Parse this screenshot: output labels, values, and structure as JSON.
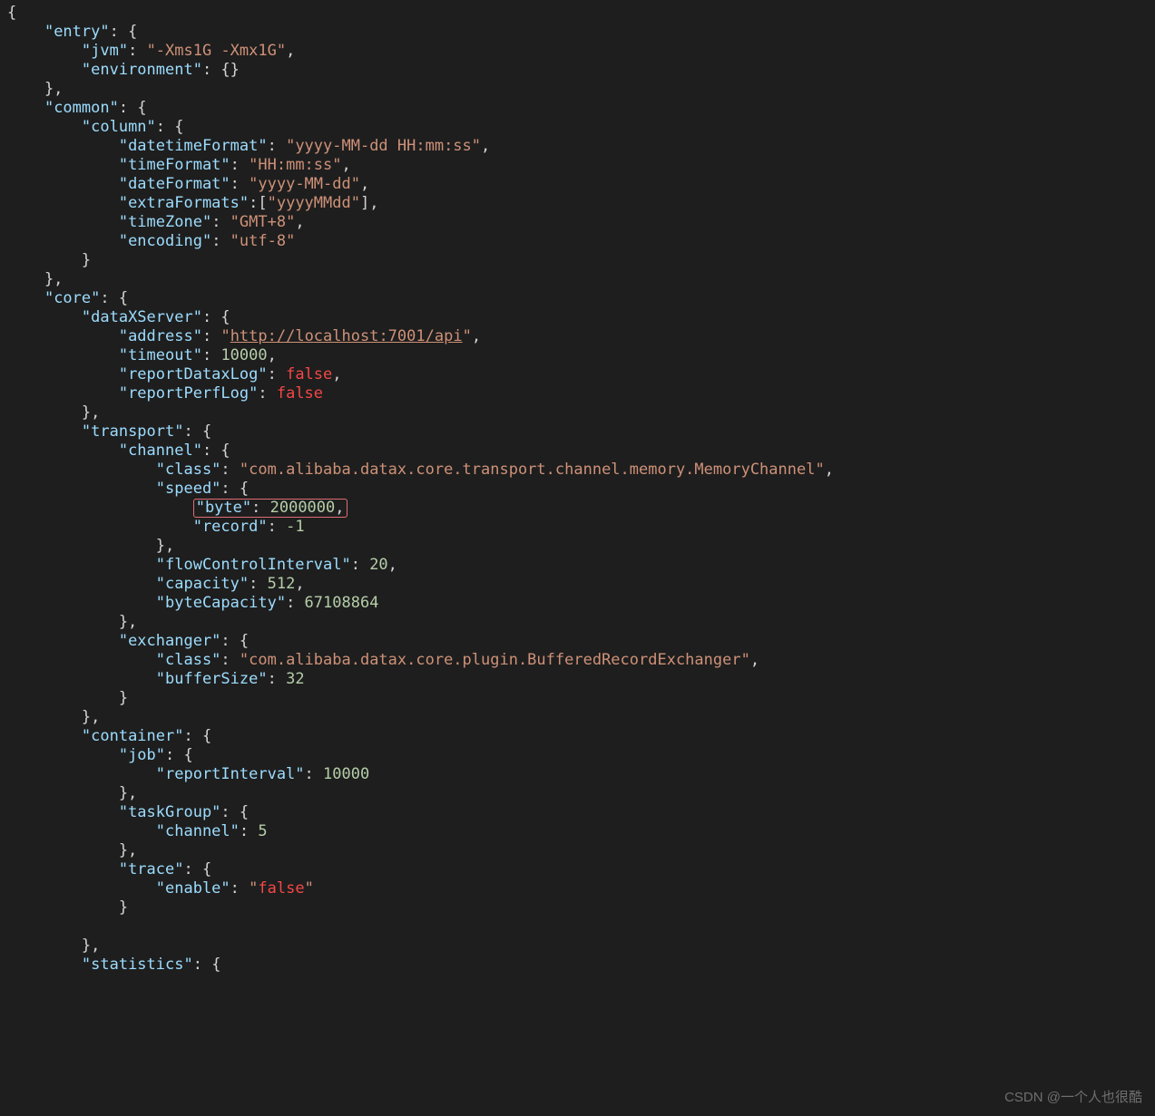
{
  "lines": [
    {
      "tokens": [
        {
          "t": "{",
          "c": "p"
        }
      ]
    },
    {
      "tokens": [
        {
          "t": "    ",
          "c": "p"
        },
        {
          "t": "\"entry\"",
          "c": "k"
        },
        {
          "t": ": {",
          "c": "p"
        }
      ]
    },
    {
      "tokens": [
        {
          "t": "        ",
          "c": "p"
        },
        {
          "t": "\"jvm\"",
          "c": "k"
        },
        {
          "t": ": ",
          "c": "p"
        },
        {
          "t": "\"-Xms1G -Xmx1G\"",
          "c": "s"
        },
        {
          "t": ",",
          "c": "p"
        }
      ]
    },
    {
      "tokens": [
        {
          "t": "        ",
          "c": "p"
        },
        {
          "t": "\"environment\"",
          "c": "k"
        },
        {
          "t": ": {}",
          "c": "p"
        }
      ]
    },
    {
      "tokens": [
        {
          "t": "    },",
          "c": "p"
        }
      ]
    },
    {
      "tokens": [
        {
          "t": "    ",
          "c": "p"
        },
        {
          "t": "\"common\"",
          "c": "k"
        },
        {
          "t": ": {",
          "c": "p"
        }
      ]
    },
    {
      "tokens": [
        {
          "t": "        ",
          "c": "p"
        },
        {
          "t": "\"column\"",
          "c": "k"
        },
        {
          "t": ": {",
          "c": "p"
        }
      ]
    },
    {
      "tokens": [
        {
          "t": "            ",
          "c": "p"
        },
        {
          "t": "\"datetimeFormat\"",
          "c": "k"
        },
        {
          "t": ": ",
          "c": "p"
        },
        {
          "t": "\"yyyy-MM-dd HH:mm:ss\"",
          "c": "s"
        },
        {
          "t": ",",
          "c": "p"
        }
      ]
    },
    {
      "tokens": [
        {
          "t": "            ",
          "c": "p"
        },
        {
          "t": "\"timeFormat\"",
          "c": "k"
        },
        {
          "t": ": ",
          "c": "p"
        },
        {
          "t": "\"HH:mm:ss\"",
          "c": "s"
        },
        {
          "t": ",",
          "c": "p"
        }
      ]
    },
    {
      "tokens": [
        {
          "t": "            ",
          "c": "p"
        },
        {
          "t": "\"dateFormat\"",
          "c": "k"
        },
        {
          "t": ": ",
          "c": "p"
        },
        {
          "t": "\"yyyy-MM-dd\"",
          "c": "s"
        },
        {
          "t": ",",
          "c": "p"
        }
      ]
    },
    {
      "tokens": [
        {
          "t": "            ",
          "c": "p"
        },
        {
          "t": "\"extraFormats\"",
          "c": "k"
        },
        {
          "t": ":[",
          "c": "p"
        },
        {
          "t": "\"yyyyMMdd\"",
          "c": "s"
        },
        {
          "t": "],",
          "c": "p"
        }
      ]
    },
    {
      "tokens": [
        {
          "t": "            ",
          "c": "p"
        },
        {
          "t": "\"timeZone\"",
          "c": "k"
        },
        {
          "t": ": ",
          "c": "p"
        },
        {
          "t": "\"GMT+8\"",
          "c": "s"
        },
        {
          "t": ",",
          "c": "p"
        }
      ]
    },
    {
      "tokens": [
        {
          "t": "            ",
          "c": "p"
        },
        {
          "t": "\"encoding\"",
          "c": "k"
        },
        {
          "t": ": ",
          "c": "p"
        },
        {
          "t": "\"utf-8\"",
          "c": "s"
        }
      ]
    },
    {
      "tokens": [
        {
          "t": "        }",
          "c": "p"
        }
      ]
    },
    {
      "tokens": [
        {
          "t": "    },",
          "c": "p"
        }
      ]
    },
    {
      "tokens": [
        {
          "t": "    ",
          "c": "p"
        },
        {
          "t": "\"core\"",
          "c": "k"
        },
        {
          "t": ": {",
          "c": "p"
        }
      ]
    },
    {
      "tokens": [
        {
          "t": "        ",
          "c": "p"
        },
        {
          "t": "\"dataXServer\"",
          "c": "k"
        },
        {
          "t": ": {",
          "c": "p"
        }
      ]
    },
    {
      "tokens": [
        {
          "t": "            ",
          "c": "p"
        },
        {
          "t": "\"address\"",
          "c": "k"
        },
        {
          "t": ": ",
          "c": "p"
        },
        {
          "t": "\"",
          "c": "s"
        },
        {
          "t": "http://localhost:7001/api",
          "c": "s u"
        },
        {
          "t": "\"",
          "c": "s"
        },
        {
          "t": ",",
          "c": "p"
        }
      ]
    },
    {
      "tokens": [
        {
          "t": "            ",
          "c": "p"
        },
        {
          "t": "\"timeout\"",
          "c": "k"
        },
        {
          "t": ": ",
          "c": "p"
        },
        {
          "t": "10000",
          "c": "n"
        },
        {
          "t": ",",
          "c": "p"
        }
      ]
    },
    {
      "tokens": [
        {
          "t": "            ",
          "c": "p"
        },
        {
          "t": "\"reportDataxLog\"",
          "c": "k"
        },
        {
          "t": ": ",
          "c": "p"
        },
        {
          "t": "false",
          "c": "b"
        },
        {
          "t": ",",
          "c": "p"
        }
      ]
    },
    {
      "tokens": [
        {
          "t": "            ",
          "c": "p"
        },
        {
          "t": "\"reportPerfLog\"",
          "c": "k"
        },
        {
          "t": ": ",
          "c": "p"
        },
        {
          "t": "false",
          "c": "b"
        }
      ]
    },
    {
      "tokens": [
        {
          "t": "        },",
          "c": "p"
        }
      ]
    },
    {
      "tokens": [
        {
          "t": "        ",
          "c": "p"
        },
        {
          "t": "\"transport\"",
          "c": "k"
        },
        {
          "t": ": {",
          "c": "p"
        }
      ]
    },
    {
      "tokens": [
        {
          "t": "            ",
          "c": "p"
        },
        {
          "t": "\"channel\"",
          "c": "k"
        },
        {
          "t": ": {",
          "c": "p"
        }
      ]
    },
    {
      "tokens": [
        {
          "t": "                ",
          "c": "p"
        },
        {
          "t": "\"class\"",
          "c": "k"
        },
        {
          "t": ": ",
          "c": "p"
        },
        {
          "t": "\"com.alibaba.datax.core.transport.channel.memory.MemoryChannel\"",
          "c": "s"
        },
        {
          "t": ",",
          "c": "p"
        }
      ]
    },
    {
      "tokens": [
        {
          "t": "                ",
          "c": "p"
        },
        {
          "t": "\"speed\"",
          "c": "k"
        },
        {
          "t": ": {",
          "c": "p"
        }
      ]
    },
    {
      "highlight": true,
      "tokens": [
        {
          "t": "                    ",
          "c": "p"
        },
        {
          "t": "\"byte\"",
          "c": "k",
          "hlstart": true
        },
        {
          "t": ": ",
          "c": "p"
        },
        {
          "t": "2000000",
          "c": "n"
        },
        {
          "t": ",",
          "c": "p",
          "hlend": true
        }
      ]
    },
    {
      "tokens": [
        {
          "t": "                    ",
          "c": "p"
        },
        {
          "t": "\"record\"",
          "c": "k"
        },
        {
          "t": ": ",
          "c": "p"
        },
        {
          "t": "-1",
          "c": "n"
        }
      ]
    },
    {
      "tokens": [
        {
          "t": "                },",
          "c": "p"
        }
      ]
    },
    {
      "tokens": [
        {
          "t": "                ",
          "c": "p"
        },
        {
          "t": "\"flowControlInterval\"",
          "c": "k"
        },
        {
          "t": ": ",
          "c": "p"
        },
        {
          "t": "20",
          "c": "n"
        },
        {
          "t": ",",
          "c": "p"
        }
      ]
    },
    {
      "tokens": [
        {
          "t": "                ",
          "c": "p"
        },
        {
          "t": "\"capacity\"",
          "c": "k"
        },
        {
          "t": ": ",
          "c": "p"
        },
        {
          "t": "512",
          "c": "n"
        },
        {
          "t": ",",
          "c": "p"
        }
      ]
    },
    {
      "tokens": [
        {
          "t": "                ",
          "c": "p"
        },
        {
          "t": "\"byteCapacity\"",
          "c": "k"
        },
        {
          "t": ": ",
          "c": "p"
        },
        {
          "t": "67108864",
          "c": "n"
        }
      ]
    },
    {
      "tokens": [
        {
          "t": "            },",
          "c": "p"
        }
      ]
    },
    {
      "tokens": [
        {
          "t": "            ",
          "c": "p"
        },
        {
          "t": "\"exchanger\"",
          "c": "k"
        },
        {
          "t": ": {",
          "c": "p"
        }
      ]
    },
    {
      "tokens": [
        {
          "t": "                ",
          "c": "p"
        },
        {
          "t": "\"class\"",
          "c": "k"
        },
        {
          "t": ": ",
          "c": "p"
        },
        {
          "t": "\"com.alibaba.datax.core.plugin.BufferedRecordExchanger\"",
          "c": "s"
        },
        {
          "t": ",",
          "c": "p"
        }
      ]
    },
    {
      "tokens": [
        {
          "t": "                ",
          "c": "p"
        },
        {
          "t": "\"bufferSize\"",
          "c": "k"
        },
        {
          "t": ": ",
          "c": "p"
        },
        {
          "t": "32",
          "c": "n"
        }
      ]
    },
    {
      "tokens": [
        {
          "t": "            }",
          "c": "p"
        }
      ]
    },
    {
      "tokens": [
        {
          "t": "        },",
          "c": "p"
        }
      ]
    },
    {
      "tokens": [
        {
          "t": "        ",
          "c": "p"
        },
        {
          "t": "\"container\"",
          "c": "k"
        },
        {
          "t": ": {",
          "c": "p"
        }
      ]
    },
    {
      "tokens": [
        {
          "t": "            ",
          "c": "p"
        },
        {
          "t": "\"job\"",
          "c": "k"
        },
        {
          "t": ": {",
          "c": "p"
        }
      ]
    },
    {
      "tokens": [
        {
          "t": "                ",
          "c": "p"
        },
        {
          "t": "\"reportInterval\"",
          "c": "k"
        },
        {
          "t": ": ",
          "c": "p"
        },
        {
          "t": "10000",
          "c": "n"
        }
      ]
    },
    {
      "tokens": [
        {
          "t": "            },",
          "c": "p"
        }
      ]
    },
    {
      "tokens": [
        {
          "t": "            ",
          "c": "p"
        },
        {
          "t": "\"taskGroup\"",
          "c": "k"
        },
        {
          "t": ": {",
          "c": "p"
        }
      ]
    },
    {
      "tokens": [
        {
          "t": "                ",
          "c": "p"
        },
        {
          "t": "\"channel\"",
          "c": "k"
        },
        {
          "t": ": ",
          "c": "p"
        },
        {
          "t": "5",
          "c": "n"
        }
      ]
    },
    {
      "tokens": [
        {
          "t": "            },",
          "c": "p"
        }
      ]
    },
    {
      "tokens": [
        {
          "t": "            ",
          "c": "p"
        },
        {
          "t": "\"trace\"",
          "c": "k"
        },
        {
          "t": ": {",
          "c": "p"
        }
      ]
    },
    {
      "tokens": [
        {
          "t": "                ",
          "c": "p"
        },
        {
          "t": "\"enable\"",
          "c": "k"
        },
        {
          "t": ": ",
          "c": "p"
        },
        {
          "t": "\"",
          "c": "s"
        },
        {
          "t": "false",
          "c": "b"
        },
        {
          "t": "\"",
          "c": "s"
        }
      ]
    },
    {
      "tokens": [
        {
          "t": "            }",
          "c": "p"
        }
      ]
    },
    {
      "tokens": [
        {
          "t": "",
          "c": "p"
        }
      ]
    },
    {
      "tokens": [
        {
          "t": "        },",
          "c": "p"
        }
      ]
    },
    {
      "tokens": [
        {
          "t": "        ",
          "c": "p"
        },
        {
          "t": "\"statistics\"",
          "c": "k"
        },
        {
          "t": ": {",
          "c": "p"
        }
      ]
    }
  ],
  "watermark": "CSDN @一个人也很酷"
}
